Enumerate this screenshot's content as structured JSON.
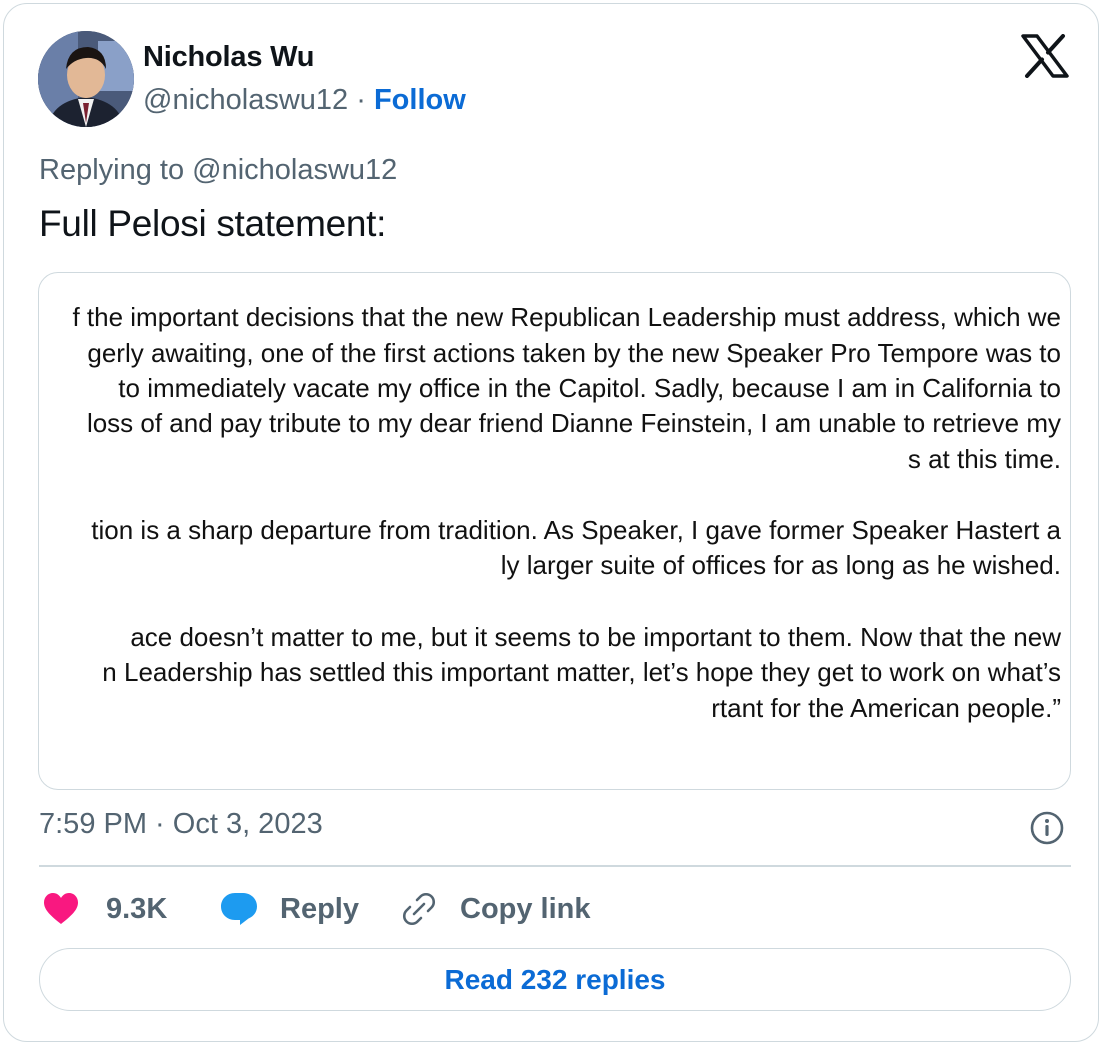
{
  "author": {
    "name": "Nicholas Wu",
    "handle": "@nicholaswu12",
    "separator": "·",
    "follow_label": "Follow"
  },
  "replying_to": "Replying to @nicholaswu12",
  "tweet_text": "Full Pelosi statement:",
  "media": {
    "statement_lines": [
      "f the important decisions that the new Republican Leadership must address, which we",
      "gerly awaiting, one of the first actions taken by the new Speaker Pro Tempore was to",
      "to immediately vacate my office in the Capitol.  Sadly, because I am in California to",
      "loss of and pay tribute to my dear friend Dianne Feinstein, I am unable to retrieve my",
      "s at this time.",
      "",
      "tion is a sharp departure from tradition.  As Speaker, I gave former Speaker Hastert a",
      "ly larger suite of offices for as long as he wished.",
      "",
      "ace doesn’t matter to me, but it seems to be important to them.  Now that the new",
      "n Leadership has settled this important matter, let’s hope they get to work on what’s",
      "rtant for the American people.”"
    ]
  },
  "timestamp": "7:59 PM · Oct 3, 2023",
  "actions": {
    "like_count": "9.3K",
    "reply_label": "Reply",
    "copy_link_label": "Copy link"
  },
  "read_replies_label": "Read 232 replies",
  "colors": {
    "like": "#f91880",
    "reply_bubble": "#1d9bf0",
    "link_blue": "#0b6bd5",
    "secondary_text": "#536471",
    "border": "#cfd9de"
  },
  "icons": [
    "x-logo-icon",
    "info-icon",
    "heart-icon",
    "reply-bubble-icon",
    "link-icon"
  ]
}
